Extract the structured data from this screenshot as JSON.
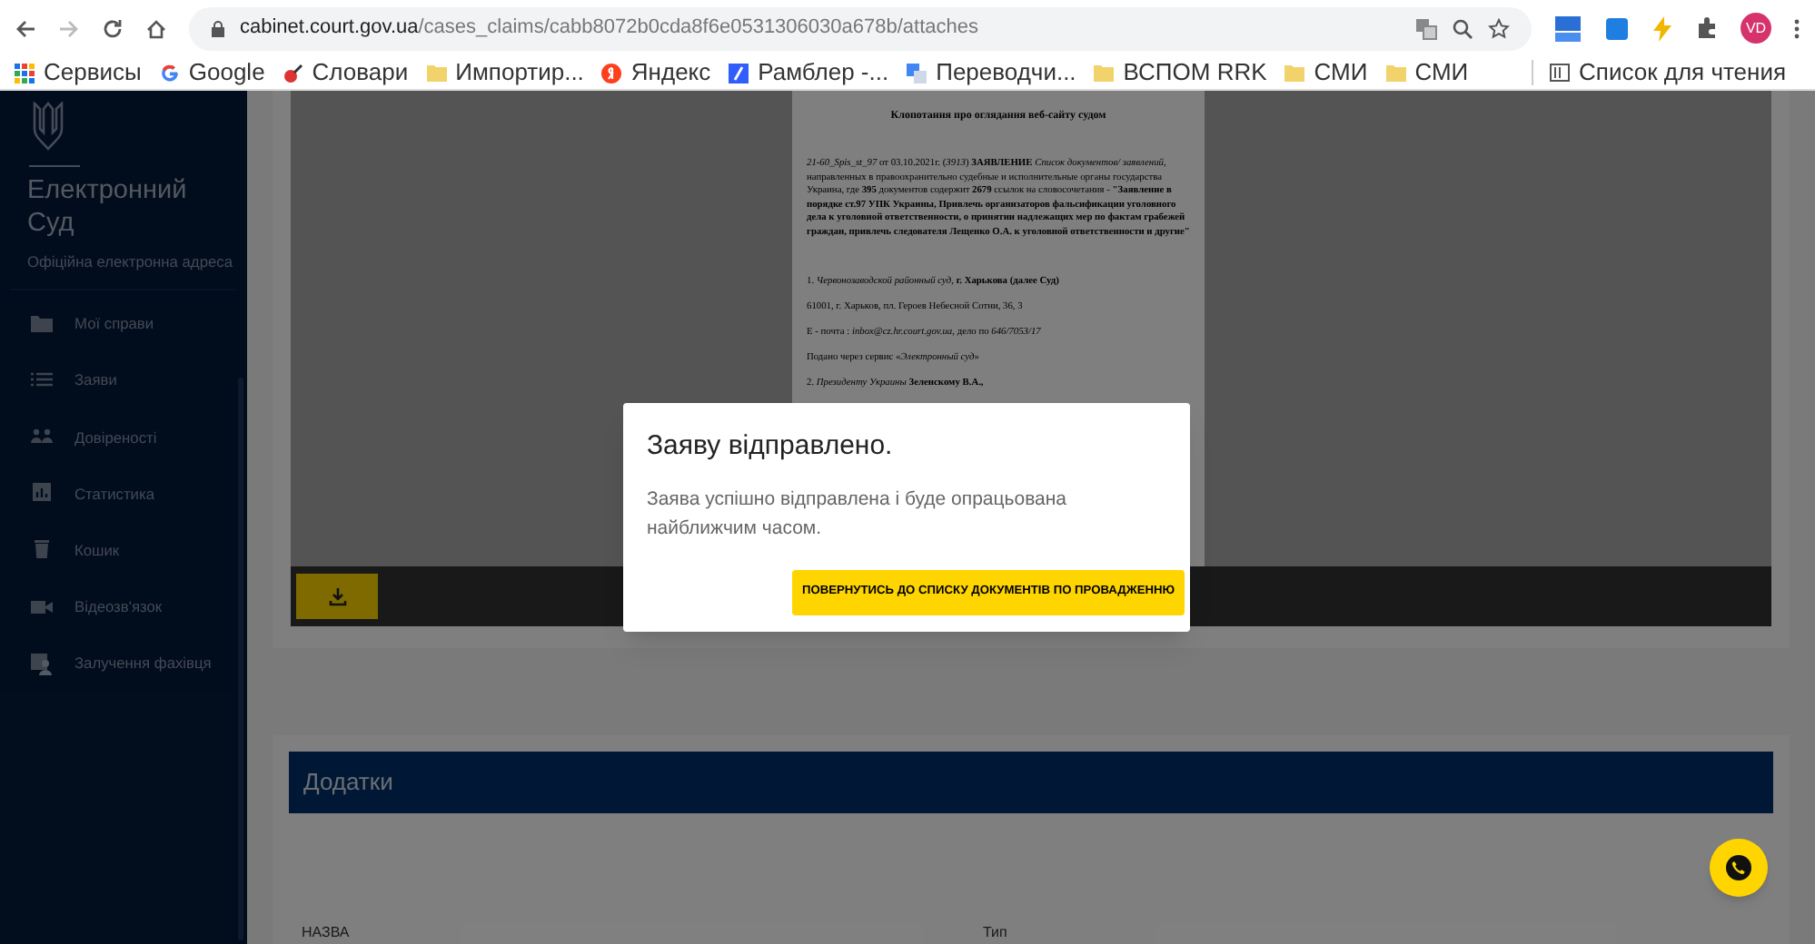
{
  "browser": {
    "url_host": "cabinet.court.gov.ua",
    "url_path": "/cases_claims/cabb8072b0cda8f6e0531306030a678b/attaches",
    "avatar": "VD",
    "bookmarks": [
      {
        "kind": "apps",
        "label": "Сервисы"
      },
      {
        "kind": "google",
        "label": "Google"
      },
      {
        "kind": "dictionary",
        "label": "Словари"
      },
      {
        "kind": "folder",
        "label": "Импортир..."
      },
      {
        "kind": "yandex",
        "label": "Яндекс"
      },
      {
        "kind": "rambler",
        "label": "Рамблер -..."
      },
      {
        "kind": "translate",
        "label": "Переводчи..."
      },
      {
        "kind": "folder",
        "label": "ВСПОМ RRK"
      },
      {
        "kind": "folder",
        "label": "СМИ"
      },
      {
        "kind": "folder",
        "label": "СМИ"
      }
    ],
    "reading_list": "Список для чтения"
  },
  "sidebar": {
    "title": "Електронний Суд",
    "subtitle": "Офіційна електронна адреса",
    "items": [
      {
        "kind": "folder",
        "label": "Мої справи"
      },
      {
        "kind": "list",
        "label": "Заяви"
      },
      {
        "kind": "people",
        "label": "Довіреності"
      },
      {
        "kind": "chart",
        "label": "Статистика"
      },
      {
        "kind": "trash",
        "label": "Кошик"
      },
      {
        "kind": "video",
        "label": "Відеозв'язок"
      },
      {
        "kind": "expert",
        "label": "Залучення фахівця"
      }
    ]
  },
  "document": {
    "title": "Клопотання про оглядання веб-сайту судом",
    "paragraphs": [
      "*21-60_Spis_st_97* от 03.10.2021г. (*3913*) **ЗАЯВЛЕНИЕ** *Список документов/ заявлений*, направленных в правоохранительно судебные и исполнительные органы государства Украина, где **395** документов содержит **2679** ссылок на словосочетания - **\"Заявление в порядке ст.97 УПК Украины, Привлечь организаторов фальсификации уголовного дела к уголовной ответственности, о принятии надлежащих мер по фактам грабежей граждан, привлечь следователя Лещенко О.А. к уголовной ответственности и другие\"**",
      "1. *Червонозаводской районный суд*, **г. Харькова (далее Суд)**",
      "61001, г. Харьков, пл. Героев Небесной Сотни, 36, 3",
      "E - почта : *inbox@cz.hr.court.gov.ua*, дело по *646/7053/17*",
      "Подано через сервис «*Электронный суд*»",
      "2. *Президенту Украины* **Зеленскому В.А.,**"
    ]
  },
  "attachments": {
    "title": "Додатки",
    "columns": [
      "НАЗВА",
      "Тип"
    ]
  },
  "modal": {
    "title": "Заяву відправлено.",
    "message": "Заява успішно відправлена і буде опрацьована найближчим часом.",
    "button": "ПОВЕРНУТИСЬ ДО СПИСКУ ДОКУМЕНТІВ ПО ПРОВАДЖЕННЮ"
  }
}
